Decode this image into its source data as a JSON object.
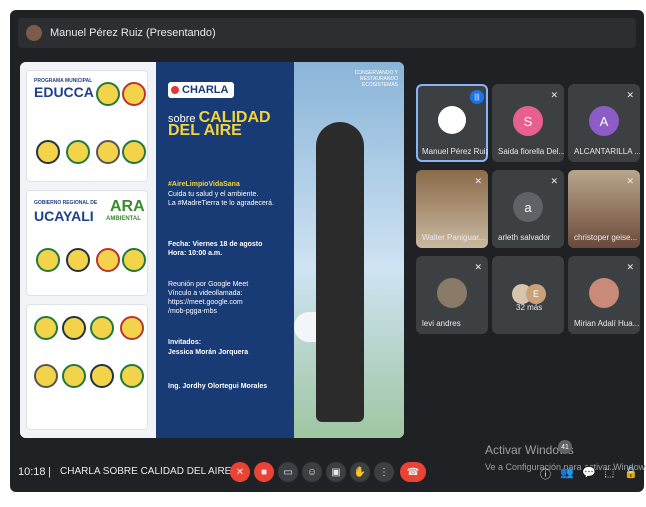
{
  "header": {
    "presenter_label": "Manuel Pérez Ruiz (Presentando)"
  },
  "slide": {
    "left_cards": [
      {
        "title": "EDUCCA",
        "subtitle": "PROGRAMA MUNICIPAL"
      },
      {
        "title": "UCAYALI",
        "subtitle": "GOBIERNO REGIONAL DE",
        "extra": "ARA",
        "extra_sub": "AMBIENTAL"
      },
      {
        "title": "",
        "subtitle": ""
      }
    ],
    "badge": "CHARLA",
    "title_small": "sobre",
    "title_big": "CALIDAD DEL AIRE",
    "hashtag": "#AireLimpioVidaSana",
    "line1": "Cuida tu salud y el ambiente.\nLa #MadreTierra te lo agradecerá.",
    "date_line": "Fecha: Viernes 18 de agosto\nHora: 10:00 a.m.",
    "meet_line": "Reunión por Google Meet\nVínculo a videollamada:\nhttps://meet.google.com\n/mob-pgga-mbs",
    "invited_label": "Invitados:",
    "guest1": "Jessica Morán Jorquera",
    "guest2": "Ing. Jordhy Olortegui Morales",
    "right_note": "CONSERVANDO Y RESTAURANDO ECOSISTEMAS"
  },
  "participants": [
    {
      "name": "Manuel Pérez Ruiz",
      "avatar": "",
      "color": "#ffffff",
      "speaking": true
    },
    {
      "name": "Saida fiorella Del...",
      "avatar": "S",
      "color": "#e8608f",
      "muted": true
    },
    {
      "name": "ALCANTARILLA ...",
      "avatar": "A",
      "color": "#8e5cc7",
      "muted": true
    },
    {
      "name": "Walter Paniguar...",
      "avatar": "",
      "muted": true
    },
    {
      "name": "arleth salvador",
      "avatar": "a",
      "color": "#5f6368",
      "muted": true
    },
    {
      "name": "christoper geise...",
      "avatar": "",
      "muted": true
    },
    {
      "name": "levi andres",
      "avatar": "",
      "muted": true
    },
    {
      "name": "32 más",
      "avatar": "E"
    },
    {
      "name": "Mirian Adalí Hua...",
      "avatar": "",
      "muted": true
    }
  ],
  "bottom": {
    "time": "10:18",
    "separator": "|",
    "meeting_name": "CHARLA SOBRE CALIDAD DEL AIRE"
  },
  "windows": {
    "title": "Activar Windows",
    "badge": "41",
    "subtitle": "Ve a Configuración para activar Windows."
  },
  "colors": {
    "background": "#202124",
    "accent": "#8ab4f8",
    "danger": "#ea4335"
  }
}
